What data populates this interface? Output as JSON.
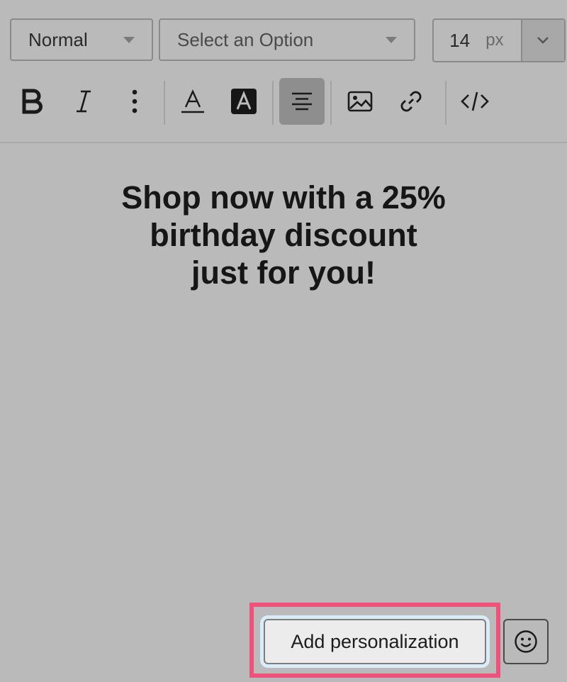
{
  "toolbar": {
    "style_select": {
      "value": "Normal"
    },
    "font_select": {
      "placeholder": "Select an Option"
    },
    "font_size": {
      "value": "14",
      "unit": "px"
    },
    "buttons": [
      {
        "icon": "bold-icon"
      },
      {
        "icon": "italic-icon"
      },
      {
        "icon": "more-vertical-icon"
      },
      {
        "icon": "text-color-icon"
      },
      {
        "icon": "highlight-color-icon"
      },
      {
        "icon": "align-center-icon",
        "active": true
      },
      {
        "icon": "image-icon"
      },
      {
        "icon": "link-icon"
      },
      {
        "icon": "code-icon"
      }
    ]
  },
  "editor": {
    "lines": [
      "Shop now with a 25%",
      "birthday discount",
      "just for you!"
    ]
  },
  "footer": {
    "personalization_label": "Add personalization",
    "emoji_icon": "smiley-icon"
  },
  "colors": {
    "background": "#bababa",
    "highlight": "#f0517a",
    "active_button": "#8e8e8e"
  }
}
